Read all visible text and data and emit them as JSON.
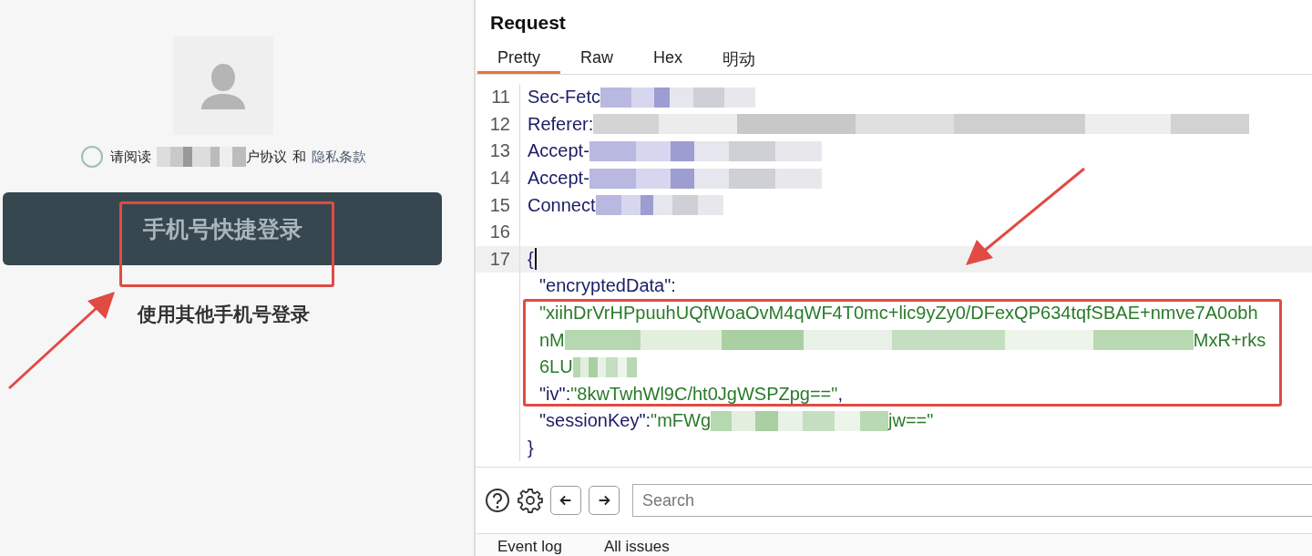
{
  "login": {
    "agreement": {
      "checked": false,
      "parts": [
        {
          "kind": "plain",
          "text": "请阅读"
        },
        {
          "kind": "blur"
        },
        {
          "kind": "plain",
          "text": "户协议"
        },
        {
          "kind": "plain",
          "text": "和"
        },
        {
          "kind": "link",
          "text": "隐私条款"
        }
      ]
    },
    "primary_button": "手机号快捷登录",
    "secondary_link": "使用其他手机号登录"
  },
  "request": {
    "title": "Request",
    "tabs": [
      {
        "label": "Pretty",
        "selected": true
      },
      {
        "label": "Raw",
        "selected": false
      },
      {
        "label": "Hex",
        "selected": false
      },
      {
        "label": "明动",
        "selected": false
      }
    ],
    "lines": [
      {
        "number": "11",
        "indent": false,
        "highlighted": false,
        "segments": [
          {
            "kind": "key",
            "text": "Sec-Fetc"
          },
          {
            "kind": "blur"
          }
        ]
      },
      {
        "number": "12",
        "indent": false,
        "highlighted": false,
        "segments": [
          {
            "kind": "key",
            "text": "Referer:"
          },
          {
            "kind": "blur"
          }
        ]
      },
      {
        "number": "13",
        "indent": false,
        "highlighted": false,
        "segments": [
          {
            "kind": "key",
            "text": "Accept-"
          },
          {
            "kind": "blur"
          }
        ]
      },
      {
        "number": "14",
        "indent": false,
        "highlighted": false,
        "segments": [
          {
            "kind": "key",
            "text": "Accept-"
          },
          {
            "kind": "blur"
          }
        ]
      },
      {
        "number": "15",
        "indent": false,
        "highlighted": false,
        "segments": [
          {
            "kind": "key",
            "text": "Connect"
          },
          {
            "kind": "blur"
          }
        ]
      },
      {
        "number": "16",
        "highlighted": false
      },
      {
        "number": "17",
        "indent": false,
        "highlighted": true,
        "segments": [
          {
            "kind": "plain",
            "text": "{"
          }
        ]
      },
      {
        "indent": true,
        "highlighted": false,
        "segments": [
          {
            "kind": "plain",
            "text": "\"encryptedData\":"
          }
        ]
      },
      {
        "indent": true,
        "highlighted": false,
        "segments": [
          {
            "kind": "value",
            "text": "\"xiihDrVrHPpuuhUQfWoaOvM4qWF4T0mc+lic9yZy0/DFexQP634tqfSBAE+nmve7A0obh"
          }
        ]
      },
      {
        "indent": true,
        "highlighted": false,
        "segments": [
          {
            "kind": "value",
            "text": "nM"
          },
          {
            "kind": "blur"
          },
          {
            "kind": "value",
            "text": "MxR+rks"
          }
        ]
      },
      {
        "indent": true,
        "highlighted": false,
        "segments": [
          {
            "kind": "value",
            "text": "6LU"
          },
          {
            "kind": "blur"
          }
        ]
      },
      {
        "indent": true,
        "highlighted": false,
        "segments": [
          {
            "kind": "plain",
            "text": "\"iv\": "
          },
          {
            "kind": "value",
            "text": "\"8kwTwhWl9C/ht0JgWSPZpg==\""
          },
          {
            "kind": "plain",
            "text": ","
          }
        ]
      },
      {
        "indent": true,
        "highlighted": false,
        "segments": [
          {
            "kind": "plain",
            "text": "\"sessionKey\":"
          },
          {
            "kind": "value",
            "text": "\"mFWg"
          },
          {
            "kind": "blur"
          },
          {
            "kind": "value",
            "text": "jw==\""
          }
        ]
      },
      {
        "indent": false,
        "highlighted": false,
        "segments": [
          {
            "kind": "plain",
            "text": "}"
          }
        ]
      }
    ],
    "search": {
      "placeholder": "Search"
    },
    "bottom_tabs": [
      "Event log",
      "All issues"
    ]
  }
}
